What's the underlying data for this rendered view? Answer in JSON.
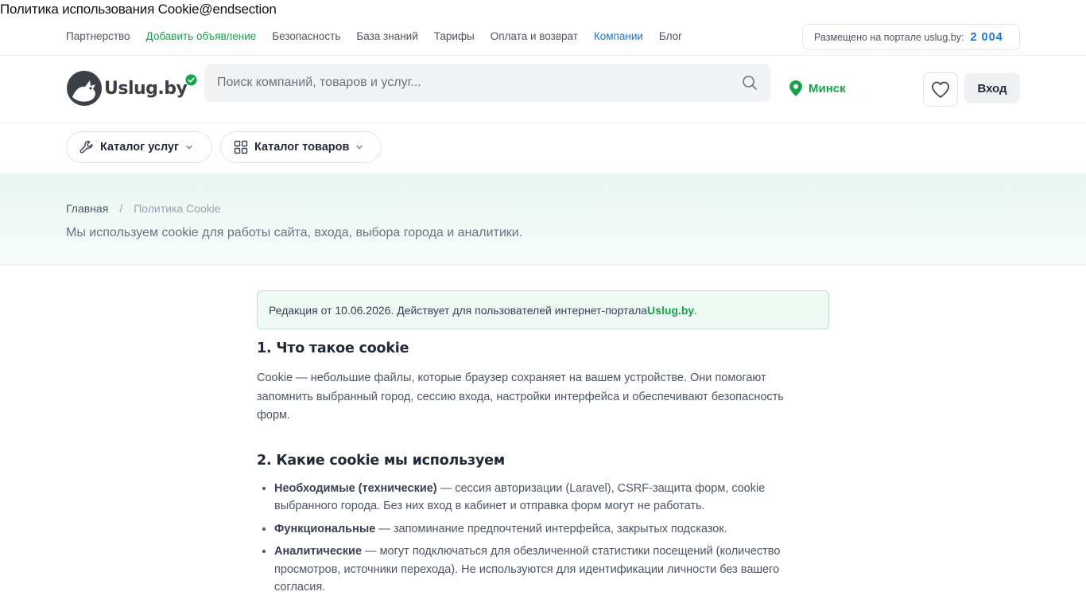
{
  "page": {
    "raw_title": "Политика использования Cookie@endsection"
  },
  "topnav": {
    "links": [
      {
        "label": "Партнерство"
      },
      {
        "label": "Добавить объявление"
      },
      {
        "label": "Безопасность"
      },
      {
        "label": "База знаний"
      },
      {
        "label": "Тарифы"
      },
      {
        "label": "Оплата и возврат"
      },
      {
        "label": "Компании"
      },
      {
        "label": "Блог"
      }
    ],
    "counter_label": "Размещено на портале uslug.by:",
    "counter_value": "2 004"
  },
  "header": {
    "logo_text": "Uslug.by",
    "search_placeholder": "Поиск компаний, товаров и услуг...",
    "city": "Минск",
    "login_label": "Вход"
  },
  "catalog": {
    "services": "Каталог услуг",
    "goods": "Каталог товаров"
  },
  "breadcrumb": {
    "home": "Главная",
    "separator": "/",
    "current": "Политика Cookie"
  },
  "hero": {
    "subtitle": "Мы используем cookie для работы сайта, входа, выбора города и аналитики."
  },
  "notice": {
    "text": "Редакция от 10.06.2026. Действует для пользователей интернет-портала ",
    "brand": "Uslug.by",
    "end": "."
  },
  "section1": {
    "title": "1. Что такое cookie",
    "body": "Cookie — небольшие файлы, которые браузер сохраняет на вашем устройстве. Они помогают запомнить выбранный город, сессию входа, настройки интерфейса и обеспечивают безопасность форм."
  },
  "section2": {
    "title": "2. Какие cookie мы используем",
    "items": [
      {
        "term": "Необходимые (технические)",
        "text": " — сессия авторизации (Laravel), CSRF-защита форм, cookie выбранного города. Без них вход в кабинет и отправка форм могут не работать."
      },
      {
        "term": "Функциональные",
        "text": " — запоминание предпочтений интерфейса, закрытых подсказок."
      },
      {
        "term": "Аналитические",
        "text": " — могут подключаться для обезличенной статистики посещений (количество просмотров, источники перехода). Не используются для идентификации личности без вашего согласия."
      }
    ]
  },
  "colors": {
    "green": "#16a34a",
    "blue": "#1976d2",
    "hero_bg": "#e9f7f1"
  }
}
